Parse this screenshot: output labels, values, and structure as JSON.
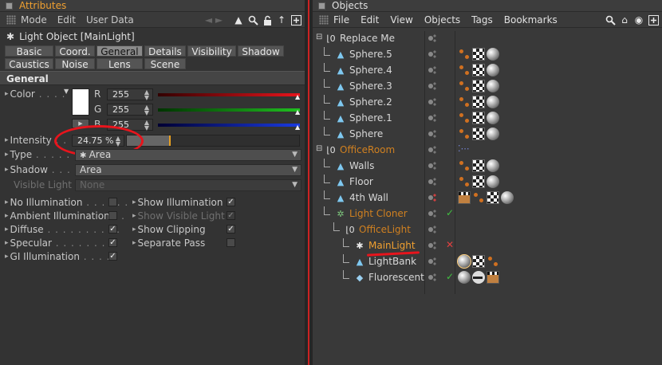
{
  "attributes": {
    "title": "Attributes",
    "menu": [
      "Mode",
      "Edit",
      "User Data"
    ],
    "object_title": "Light Object [MainLight]",
    "tabs": [
      {
        "label": "Basic",
        "active": false
      },
      {
        "label": "Coord.",
        "active": false
      },
      {
        "label": "General",
        "active": true
      },
      {
        "label": "Details",
        "active": false
      },
      {
        "label": "Visibility",
        "active": false
      },
      {
        "label": "Shadow",
        "active": false
      },
      {
        "label": "Caustics",
        "active": false
      },
      {
        "label": "Noise",
        "active": false
      },
      {
        "label": "Lens",
        "active": false
      },
      {
        "label": "Scene",
        "active": false
      }
    ],
    "section": "General",
    "color": {
      "label": "Color",
      "swatch": "#ffffff",
      "r_label": "R",
      "r_value": "255",
      "g_label": "G",
      "g_value": "255",
      "b_label": "B",
      "b_value": "255"
    },
    "intensity": {
      "label": "Intensity",
      "value": "24.75 %",
      "fraction": 0.2475
    },
    "type": {
      "label": "Type",
      "value": "Area"
    },
    "shadow": {
      "label": "Shadow",
      "value": "Area"
    },
    "visible_light": {
      "label": "Visible Light",
      "value": "None"
    },
    "checks_left": [
      {
        "label": "No Illumination",
        "checked": false
      },
      {
        "label": "Ambient Illumination",
        "checked": false
      },
      {
        "label": "Diffuse",
        "checked": true
      },
      {
        "label": "Specular",
        "checked": true
      },
      {
        "label": "GI Illumination",
        "checked": true
      }
    ],
    "checks_right": [
      {
        "label": "Show Illumination",
        "checked": true,
        "dim": false
      },
      {
        "label": "Show Visible Light",
        "checked": true,
        "dim": true
      },
      {
        "label": "Show Clipping",
        "checked": true,
        "dim": false
      },
      {
        "label": "Separate Pass",
        "checked": false,
        "dim": false
      }
    ],
    "colors": {
      "red": "#e8141c",
      "green": "#20c020",
      "blue": "#1a3ae0",
      "accent": "#f0a030"
    }
  },
  "objects": {
    "title": "Objects",
    "menu": [
      "File",
      "Edit",
      "View",
      "Objects",
      "Tags",
      "Bookmarks"
    ],
    "rows": [
      {
        "name": "Replace Me",
        "icon": "null-icon",
        "depth": 0,
        "style": "normal",
        "dot": "gray",
        "mark": "",
        "tags": []
      },
      {
        "name": "Sphere.5",
        "icon": "sphere-obj-icon",
        "depth": 1,
        "style": "normal",
        "dot": "gray",
        "mark": "",
        "tags": [
          "phong",
          "check",
          "sphere"
        ]
      },
      {
        "name": "Sphere.4",
        "icon": "sphere-obj-icon",
        "depth": 1,
        "style": "normal",
        "dot": "gray",
        "mark": "",
        "tags": [
          "phong",
          "check",
          "sphere"
        ]
      },
      {
        "name": "Sphere.3",
        "icon": "sphere-obj-icon",
        "depth": 1,
        "style": "normal",
        "dot": "gray",
        "mark": "",
        "tags": [
          "phong",
          "check",
          "sphere"
        ]
      },
      {
        "name": "Sphere.2",
        "icon": "sphere-obj-icon",
        "depth": 1,
        "style": "normal",
        "dot": "gray",
        "mark": "",
        "tags": [
          "phong",
          "check",
          "sphere"
        ]
      },
      {
        "name": "Sphere.1",
        "icon": "sphere-obj-icon",
        "depth": 1,
        "style": "normal",
        "dot": "gray",
        "mark": "",
        "tags": [
          "phong",
          "check",
          "sphere"
        ]
      },
      {
        "name": "Sphere",
        "icon": "sphere-obj-icon",
        "depth": 1,
        "style": "normal",
        "dot": "gray",
        "mark": "",
        "tags": [
          "phong",
          "check",
          "sphere"
        ]
      },
      {
        "name": "OfficeRoom",
        "icon": "null-icon",
        "depth": 0,
        "style": "orange",
        "dot": "gray",
        "mark": "",
        "tags": [
          "dots"
        ]
      },
      {
        "name": "Walls",
        "icon": "sphere-obj-icon",
        "depth": 1,
        "style": "normal",
        "dot": "gray",
        "mark": "",
        "tags": [
          "phong",
          "check",
          "sphere"
        ]
      },
      {
        "name": "Floor",
        "icon": "sphere-obj-icon",
        "depth": 1,
        "style": "normal",
        "dot": "gray",
        "mark": "",
        "tags": [
          "phong",
          "check",
          "sphere"
        ]
      },
      {
        "name": "4th Wall",
        "icon": "sphere-obj-icon",
        "depth": 1,
        "style": "normal",
        "dot": "red",
        "mark": "",
        "tags": [
          "clap",
          "phong",
          "check",
          "sphere"
        ]
      },
      {
        "name": "Light Cloner",
        "icon": "cloner-icon",
        "depth": 1,
        "style": "orange",
        "dot": "gray",
        "mark": "✓",
        "tags": []
      },
      {
        "name": "OfficeLight",
        "icon": "null-icon",
        "depth": 2,
        "style": "orange",
        "dot": "gray",
        "mark": "",
        "tags": []
      },
      {
        "name": "MainLight",
        "icon": "light-icon",
        "depth": 3,
        "style": "selected",
        "dot": "gray",
        "mark": "✕",
        "tags": []
      },
      {
        "name": "LightBank",
        "icon": "sphere-obj-icon",
        "depth": 3,
        "style": "normal",
        "dot": "gray",
        "mark": "",
        "tags": [
          "sphere-sel",
          "check",
          "phong"
        ]
      },
      {
        "name": "Fluorescent",
        "icon": "plane-icon",
        "depth": 3,
        "style": "normal",
        "dot": "gray",
        "mark": "✓",
        "tags": [
          "sphere",
          "comp",
          "clap"
        ]
      }
    ]
  }
}
